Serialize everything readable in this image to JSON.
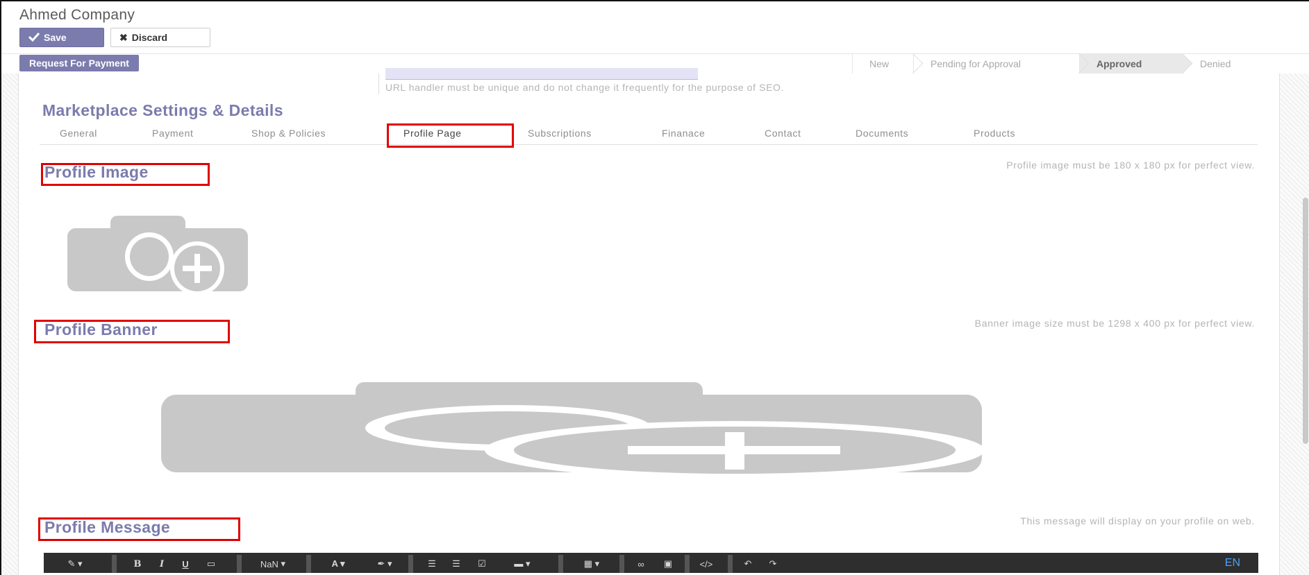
{
  "header": {
    "title": "Ahmed Company"
  },
  "toolbar": {
    "save_label": "Save",
    "discard_label": "Discard",
    "request_payment_label": "Request For Payment"
  },
  "status_stages": [
    {
      "label": "New",
      "active": false
    },
    {
      "label": "Pending for Approval",
      "active": false
    },
    {
      "label": "Approved",
      "active": true
    },
    {
      "label": "Denied",
      "active": false
    }
  ],
  "url_help": "URL handler must be unique and do not change it frequently for the purpose of SEO.",
  "section_title": "Marketplace Settings & Details",
  "tabs": [
    "General",
    "Payment",
    "Shop & Policies",
    "Profile Page",
    "Subscriptions",
    "Finanace",
    "Contact",
    "Documents",
    "Products"
  ],
  "active_tab": "Profile Page",
  "profile_image": {
    "title": "Profile Image",
    "hint": "Profile image must be 180 x 180 px for perfect view."
  },
  "profile_banner": {
    "title": "Profile Banner",
    "hint": "Banner image size must be 1298 x 400 px for perfect view."
  },
  "profile_message": {
    "title": "Profile Message",
    "hint": "This message will display on your profile on web."
  },
  "editor": {
    "font_size_label": "NaN",
    "lang": "EN"
  },
  "colors": {
    "accent": "#7c7bad",
    "highlight_box": "#e10000",
    "editor_bg": "#2e2e2e"
  }
}
